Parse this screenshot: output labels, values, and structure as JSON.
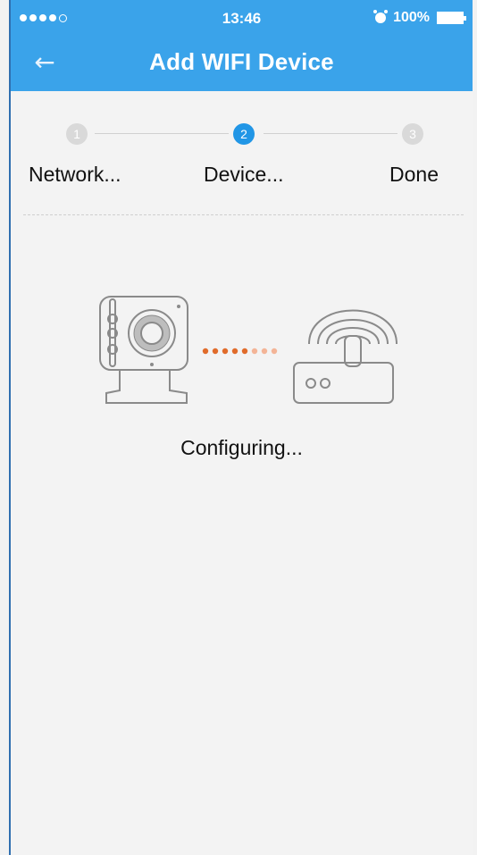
{
  "status_bar": {
    "time": "13:46",
    "battery": "100%"
  },
  "navbar": {
    "title": "Add WIFI Device",
    "back_icon": "arrow-left-icon"
  },
  "steps": [
    {
      "number": "1",
      "label": "Network...",
      "active": false
    },
    {
      "number": "2",
      "label": "Device...",
      "active": true
    },
    {
      "number": "3",
      "label": "Done",
      "active": false
    }
  ],
  "main": {
    "status_text": "Configuring...",
    "icons": [
      "camera-icon",
      "router-icon",
      "progress-dots-icon"
    ]
  },
  "colors": {
    "topbar": "#3aa3ea",
    "active_step": "#2196e6",
    "inactive_step": "#d9d9d9",
    "progress_dark": "#e06b2a",
    "progress_light": "#f3b497"
  }
}
